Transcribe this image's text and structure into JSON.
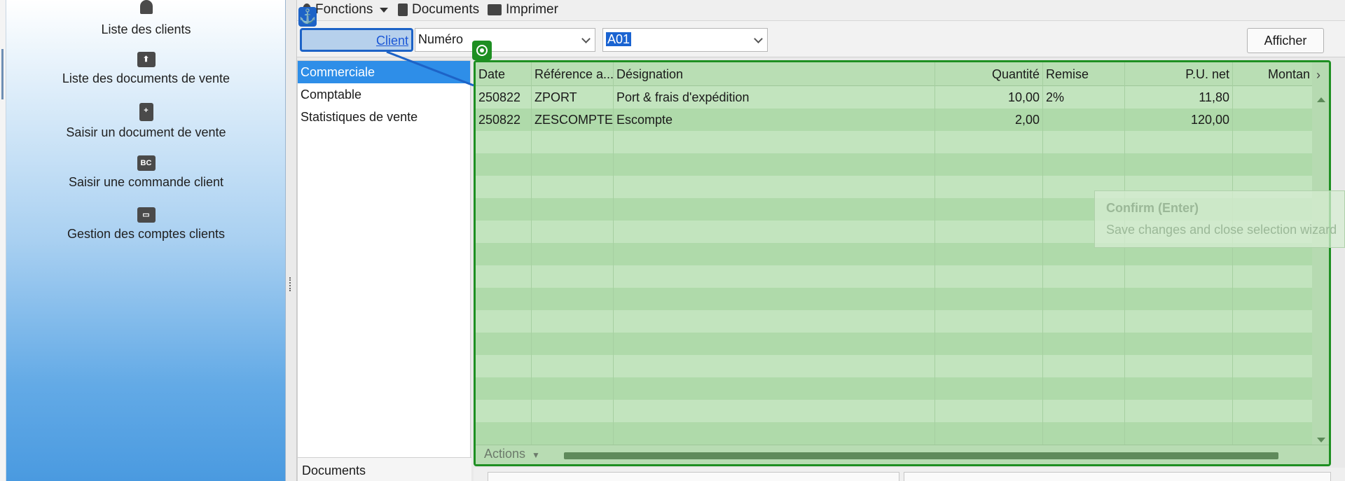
{
  "sidebar": {
    "items": [
      {
        "label": "Liste des clients",
        "icon": "person-icon"
      },
      {
        "label": "Liste des documents de vente",
        "icon": "tray-icon"
      },
      {
        "label": "Saisir un document de vente",
        "icon": "document-add-icon"
      },
      {
        "label": "Saisir une commande client",
        "icon": "bc-icon",
        "icon_text": "BC"
      },
      {
        "label": "Gestion des comptes clients",
        "icon": "toolbox-icon"
      }
    ]
  },
  "toolbar": {
    "functions_label": "Fonctions",
    "documents_label": "Documents",
    "print_label": "Imprimer"
  },
  "filter": {
    "client_link": "Client",
    "field_value": "Numéro",
    "search_value": "A01",
    "show_button": "Afficher"
  },
  "categories": {
    "items": [
      "Commerciale",
      "Comptable",
      "Statistiques de vente"
    ],
    "active": "Commerciale",
    "bottom_label": "Documents"
  },
  "grid": {
    "columns": [
      "Date",
      "Référence a...",
      "Désignation",
      "Quantité",
      "Remise",
      "P.U. net",
      "Montan"
    ],
    "rows": [
      [
        "250822",
        "ZPORT",
        "Port & frais d'expédition",
        "10,00",
        "2%",
        "11,80",
        ""
      ],
      [
        "250822",
        "ZESCOMPTE",
        "Escompte",
        "2,00",
        "",
        "120,00",
        ""
      ]
    ],
    "actions_label": "Actions"
  },
  "tooltip": {
    "title": "Confirm (Enter)",
    "text": "Save changes and close selection wizard"
  },
  "colors": {
    "selection_blue": "#1d63c7",
    "grid_green": "#1e8f22",
    "active_row": "#2e8ee8"
  }
}
